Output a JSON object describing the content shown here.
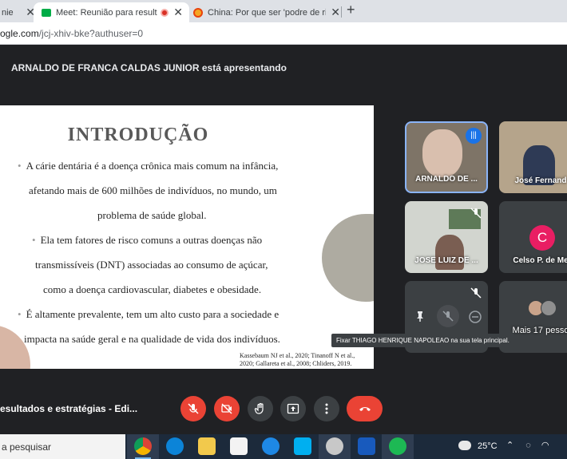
{
  "browser": {
    "tabs": [
      {
        "title": "nie",
        "active": false
      },
      {
        "title": "Meet: Reunião para resultad",
        "active": true
      },
      {
        "title": "China: Por que ser 'podre de rico",
        "active": false
      }
    ],
    "new_tab": "+",
    "close_glyph": "✕",
    "url_host": "ogle.com",
    "url_path": "/jcj-xhiv-bke?authuser=0"
  },
  "meet": {
    "presenting_banner": "ARNALDO DE FRANCA CALDAS JUNIOR está apresentando",
    "slide": {
      "title": "INTRODUÇÃO",
      "lines": [
        "A cárie dentária é a doença crônica mais comum na infância,",
        "afetando mais de 600 milhões de indivíduos, no mundo, um",
        "problema de saúde global.",
        "Ela tem fatores de risco comuns a outras doenças não",
        "transmissíveis (DNT) associadas ao consumo de açúcar,",
        "como a doença cardiovascular, diabetes e obesidade.",
        "É altamente prevalente, tem um alto custo para a sociedade e",
        "impacta na saúde geral e na qualidade de vida dos indivíduos."
      ],
      "bullet": "•",
      "citation_1": "Kassebaum NJ et al., 2020; Tinanoff N et al.,",
      "citation_2": "2020; Gallareta et al., 2008; Chliders, 2019."
    },
    "participants": [
      {
        "name": "ARNALDO DE ...",
        "speaking": true
      },
      {
        "name": "José Fernand",
        "speaking": false
      },
      {
        "name": "JOSE LUIZ DE ...",
        "speaking": false,
        "muted": true
      },
      {
        "name": "Celso P. de Me",
        "avatar_letter": "C",
        "avatar_color": "#e91e63"
      },
      {
        "name": "",
        "muted": true
      },
      {
        "name": "Mais 17 pesso"
      }
    ],
    "tooltip": "Fixar THIAGO HENRIQUE NAPOLEAO na sua tela principal.",
    "meeting_name": "esultados e estratégias - Edi...",
    "accent_red": "#ea4335",
    "accent_blue": "#1a73e8"
  },
  "taskbar": {
    "search_placeholder": "a pesquisar",
    "temperature": "25°C"
  }
}
